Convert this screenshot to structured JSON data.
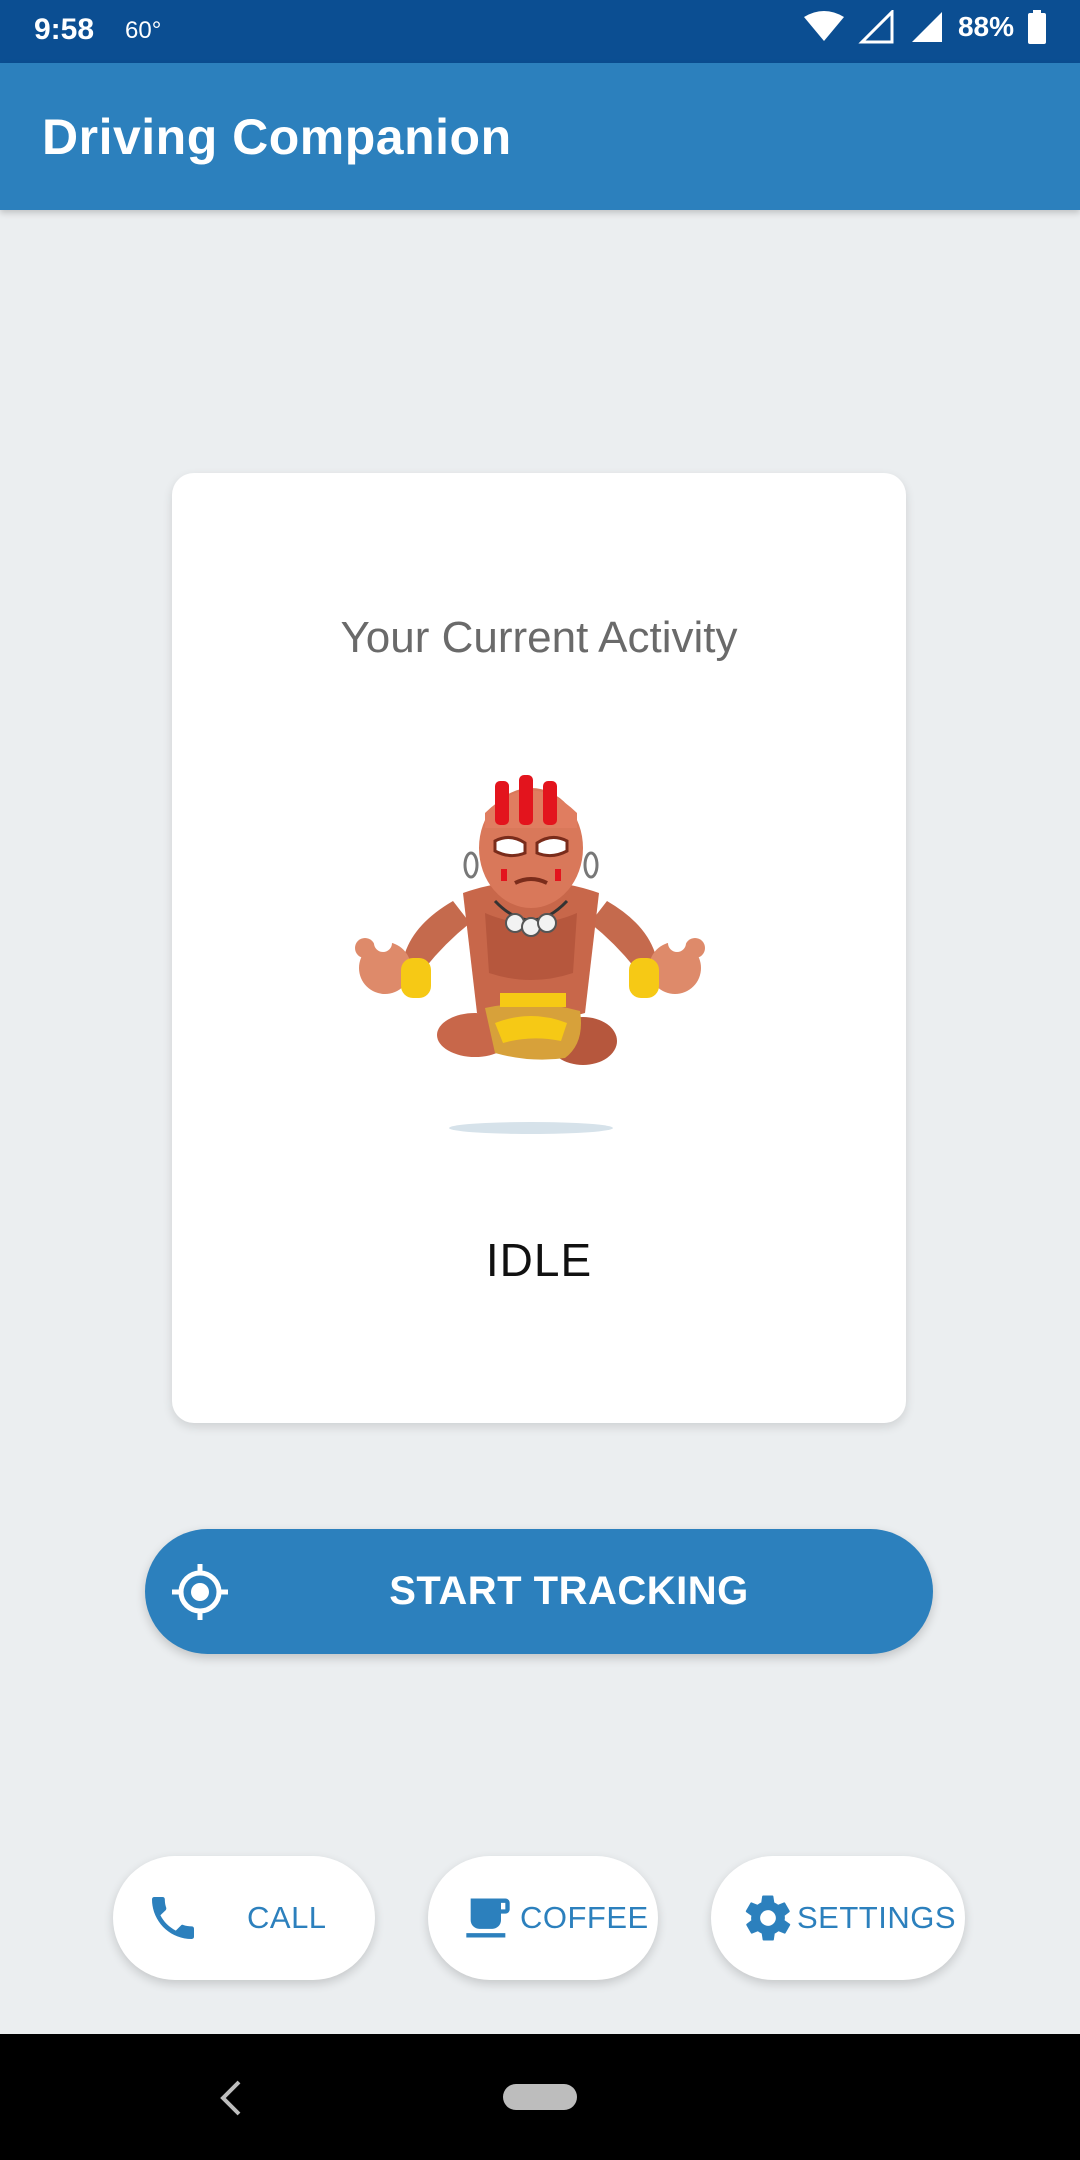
{
  "status_bar": {
    "time": "9:58",
    "temperature": "60°",
    "battery": "88%"
  },
  "app_bar": {
    "title": "Driving Companion"
  },
  "activity_card": {
    "title": "Your Current Activity",
    "status": "IDLE",
    "illustration": "meditating-character"
  },
  "start_button": {
    "label": "START TRACKING",
    "icon": "crosshair-icon"
  },
  "actions": [
    {
      "label": "CALL",
      "icon": "phone-icon"
    },
    {
      "label": "COFFEE",
      "icon": "coffee-icon"
    },
    {
      "label": "SETTINGS",
      "icon": "gear-icon"
    }
  ],
  "colors": {
    "primary": "#2c80bd",
    "status_bar": "#0b4e92",
    "background": "#ebeef0"
  }
}
